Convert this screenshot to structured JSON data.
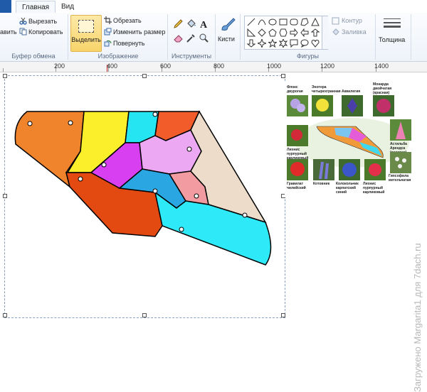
{
  "tabs": {
    "file_label": "",
    "home": "Главная",
    "view": "Вид"
  },
  "clipboard": {
    "paste_partial": "авить",
    "cut": "Вырезать",
    "copy": "Копировать",
    "group": "Буфер обмена"
  },
  "image": {
    "select": "Выделить",
    "crop": "Обрезать",
    "resize": "Изменить размер",
    "rotate": "Повернуть",
    "group": "Изображение"
  },
  "tools": {
    "group": "Инструменты"
  },
  "brushes": {
    "label": "Кисти"
  },
  "shapes": {
    "outline": "Контур",
    "fill": "Заливка",
    "group": "Фигуры"
  },
  "size": {
    "label": "Толщина"
  },
  "ruler": {
    "marks": [
      "200",
      "400",
      "600",
      "800",
      "1000",
      "1200",
      "1400"
    ]
  },
  "illustration": {
    "labels": [
      "Флокс двурогая",
      "Энотера четырехгранная",
      "Аквилегия",
      "Монарда двойчатая (красная)",
      "Астильба Арендса (розовая)",
      "Лихнис пурпурный карликовый",
      "Гипсофила метельчатая",
      "Гравилат чилийский",
      "Котовник",
      "Колокольчик карпатский синий",
      "Лихнис пурпурный карликовый"
    ]
  },
  "watermark": "Загружено Margarita1 для 7dach.ru",
  "colors": {
    "orange": "#f0842c",
    "yellow": "#fbef2c",
    "cyan": "#25e5f3",
    "red_orange": "#f25c2a",
    "deep_orange": "#e24a12",
    "magenta": "#d83ff0",
    "light_violet": "#eca8f2",
    "blue": "#2aa6e3",
    "pink": "#f29ca1",
    "tan": "#ecdcc9",
    "bright_cyan": "#2ee9f7"
  }
}
